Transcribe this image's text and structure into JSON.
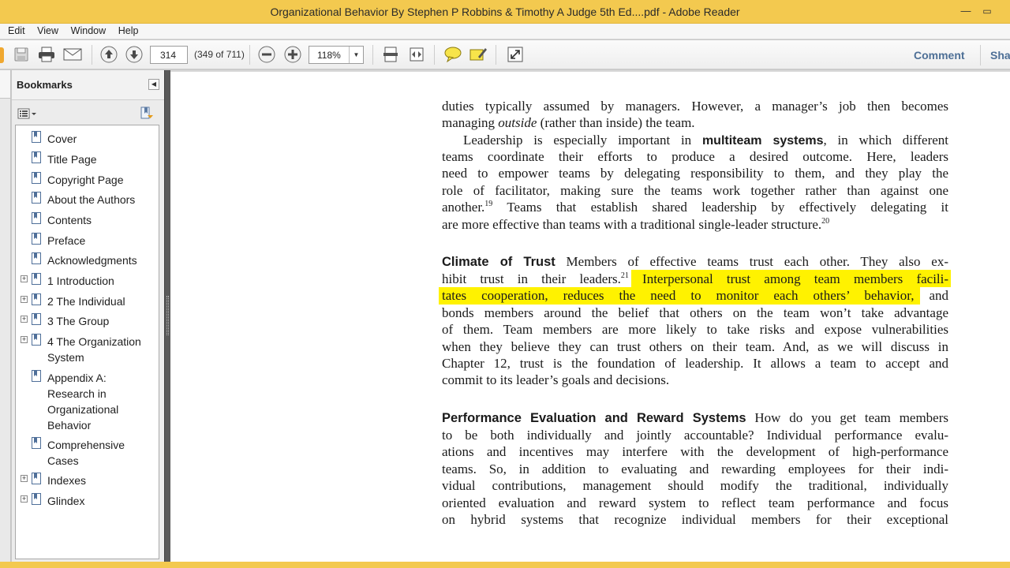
{
  "window": {
    "title": "Organizational Behavior By Stephen P Robbins & Timothy A Judge 5th Ed....pdf - Adobe Reader",
    "minimize_glyph": "—",
    "maximize_glyph": "▭"
  },
  "menu": {
    "items": [
      "Edit",
      "View",
      "Window",
      "Help"
    ]
  },
  "toolbar": {
    "page_number": "314",
    "page_count": "(349 of 711)",
    "zoom": "118%",
    "comment_label": "Comment",
    "share_label": "Sha",
    "icons": [
      "save-icon",
      "print-icon",
      "email-icon",
      "previous-page-icon",
      "next-page-icon",
      "zoom-out-icon",
      "zoom-in-icon",
      "fit-page-icon",
      "fit-width-icon",
      "comment-bubble-icon",
      "highlight-icon",
      "fullscreen-icon"
    ]
  },
  "bookmarks": {
    "title": "Bookmarks",
    "items": [
      {
        "label": "Cover",
        "expandable": false
      },
      {
        "label": "Title Page",
        "expandable": false
      },
      {
        "label": "Copyright Page",
        "expandable": false
      },
      {
        "label": "About the Authors",
        "expandable": false
      },
      {
        "label": "Contents",
        "expandable": false
      },
      {
        "label": "Preface",
        "expandable": false
      },
      {
        "label": "Acknowledgments",
        "expandable": false
      },
      {
        "label": "1 Introduction",
        "expandable": true
      },
      {
        "label": "2 The Individual",
        "expandable": true
      },
      {
        "label": "3 The Group",
        "expandable": true
      },
      {
        "label": "4 The Organization\nSystem",
        "expandable": true
      },
      {
        "label": "Appendix A:\nResearch in\nOrganizational\nBehavior",
        "expandable": false
      },
      {
        "label": "Comprehensive\nCases",
        "expandable": false
      },
      {
        "label": "Indexes",
        "expandable": true
      },
      {
        "label": "Glindex",
        "expandable": true
      }
    ]
  },
  "document": {
    "colors": {
      "highlight": "#fff200"
    },
    "p1": {
      "l1": "duties typically assumed by managers. However, a manager’s job then becomes",
      "l2a": "managing ",
      "l2b": "outside",
      "l2c": " (rather than inside) the team."
    },
    "p2": {
      "l1a": "Leadership is especially important in ",
      "l1b": "multiteam systems",
      "l1c": ", in which different",
      "l2": "teams coordinate their efforts to produce a desired outcome. Here, leaders",
      "l3": "need to empower teams by delegating responsibility to them, and they play the",
      "l4": "role of facilitator, making sure the teams work together rather than against one",
      "l5a": "another.",
      "l5sup": "19",
      "l5b": " Teams that establish shared leadership by effectively delegating it",
      "l6": "are more effective than teams with a traditional single-leader structure.",
      "l6sup": "20"
    },
    "p3": {
      "heading": "Climate of Trust",
      "l1b": "Members of effective teams trust each other. They also ex-",
      "l2a": "hibit trust in their leaders.",
      "l2sup": "21",
      "l2hl": "Interpersonal trust among team members facili-",
      "l3hl": "tates cooperation, reduces the need to monitor each others’ behavior,",
      "l3b": " and",
      "l4": "bonds members around the belief that others on the team won’t take advantage",
      "l5": "of them. Team members are more likely to take risks and expose vulnerabilities",
      "l6": "when they believe they can trust others on their team. And, as we will discuss in",
      "l7": "Chapter 12, trust is the foundation of leadership. It allows a team to accept and",
      "l8": "commit to its leader’s goals and decisions."
    },
    "p4": {
      "heading": "Performance Evaluation and Reward Systems",
      "l1b": "How do you get team members",
      "l2": "to be both individually and jointly accountable? Individual performance evalu-",
      "l3": "ations and incentives may interfere with the development of high-performance",
      "l4": "teams. So, in addition to evaluating and rewarding employees for their indi-",
      "l5": "vidual contributions, management should modify the traditional, individually",
      "l6": "oriented evaluation and reward system to reflect team performance and focus",
      "l7": "on hybrid systems that recognize individual members for their exceptional"
    }
  }
}
